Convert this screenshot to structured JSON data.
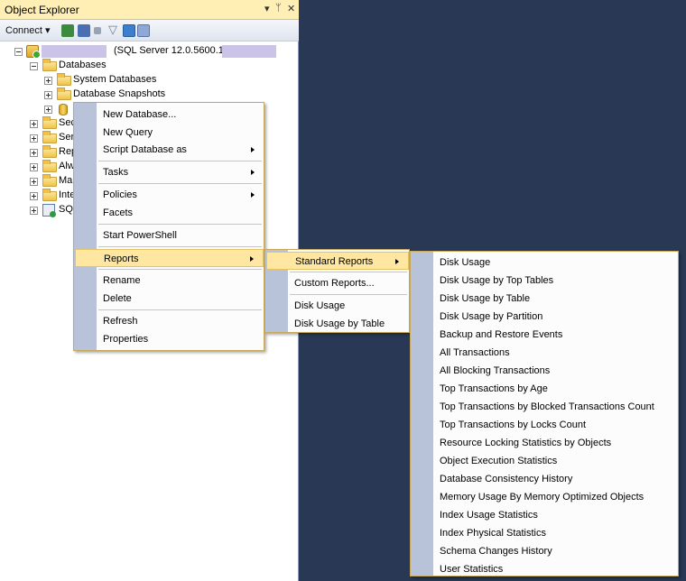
{
  "panel": {
    "title": "Object Explorer",
    "pin": "▾ ⊥ ✕",
    "toolbar": {
      "connect_label": "Connect ▾"
    }
  },
  "tree": {
    "server_label": "(SQL Server 12.0.5600.1 -",
    "databases": "Databases",
    "system_databases": "System Databases",
    "database_snapshots": "Database Snapshots",
    "truncated": [
      "Sec",
      "Serv",
      "Rep",
      "Alw",
      "Mar",
      "Inte",
      "SQL"
    ]
  },
  "context_menu": {
    "items": [
      "New Database...",
      "New Query",
      "Script Database as",
      "Tasks",
      "Policies",
      "Facets",
      "Start PowerShell",
      "Reports",
      "Rename",
      "Delete",
      "Refresh",
      "Properties"
    ]
  },
  "reports_menu": {
    "items": [
      "Standard Reports",
      "Custom Reports...",
      "Disk Usage",
      "Disk Usage by Table"
    ]
  },
  "standard_reports_menu": {
    "items": [
      "Disk Usage",
      "Disk Usage by Top Tables",
      "Disk Usage by Table",
      "Disk Usage by Partition",
      "Backup and Restore Events",
      "All Transactions",
      "All Blocking Transactions",
      "Top Transactions by Age",
      "Top Transactions by Blocked Transactions Count",
      "Top Transactions by Locks Count",
      "Resource Locking Statistics by Objects",
      "Object Execution Statistics",
      "Database Consistency History",
      "Memory Usage By Memory Optimized Objects",
      "Index Usage Statistics",
      "Index Physical Statistics",
      "Schema Changes History",
      "User Statistics"
    ]
  }
}
